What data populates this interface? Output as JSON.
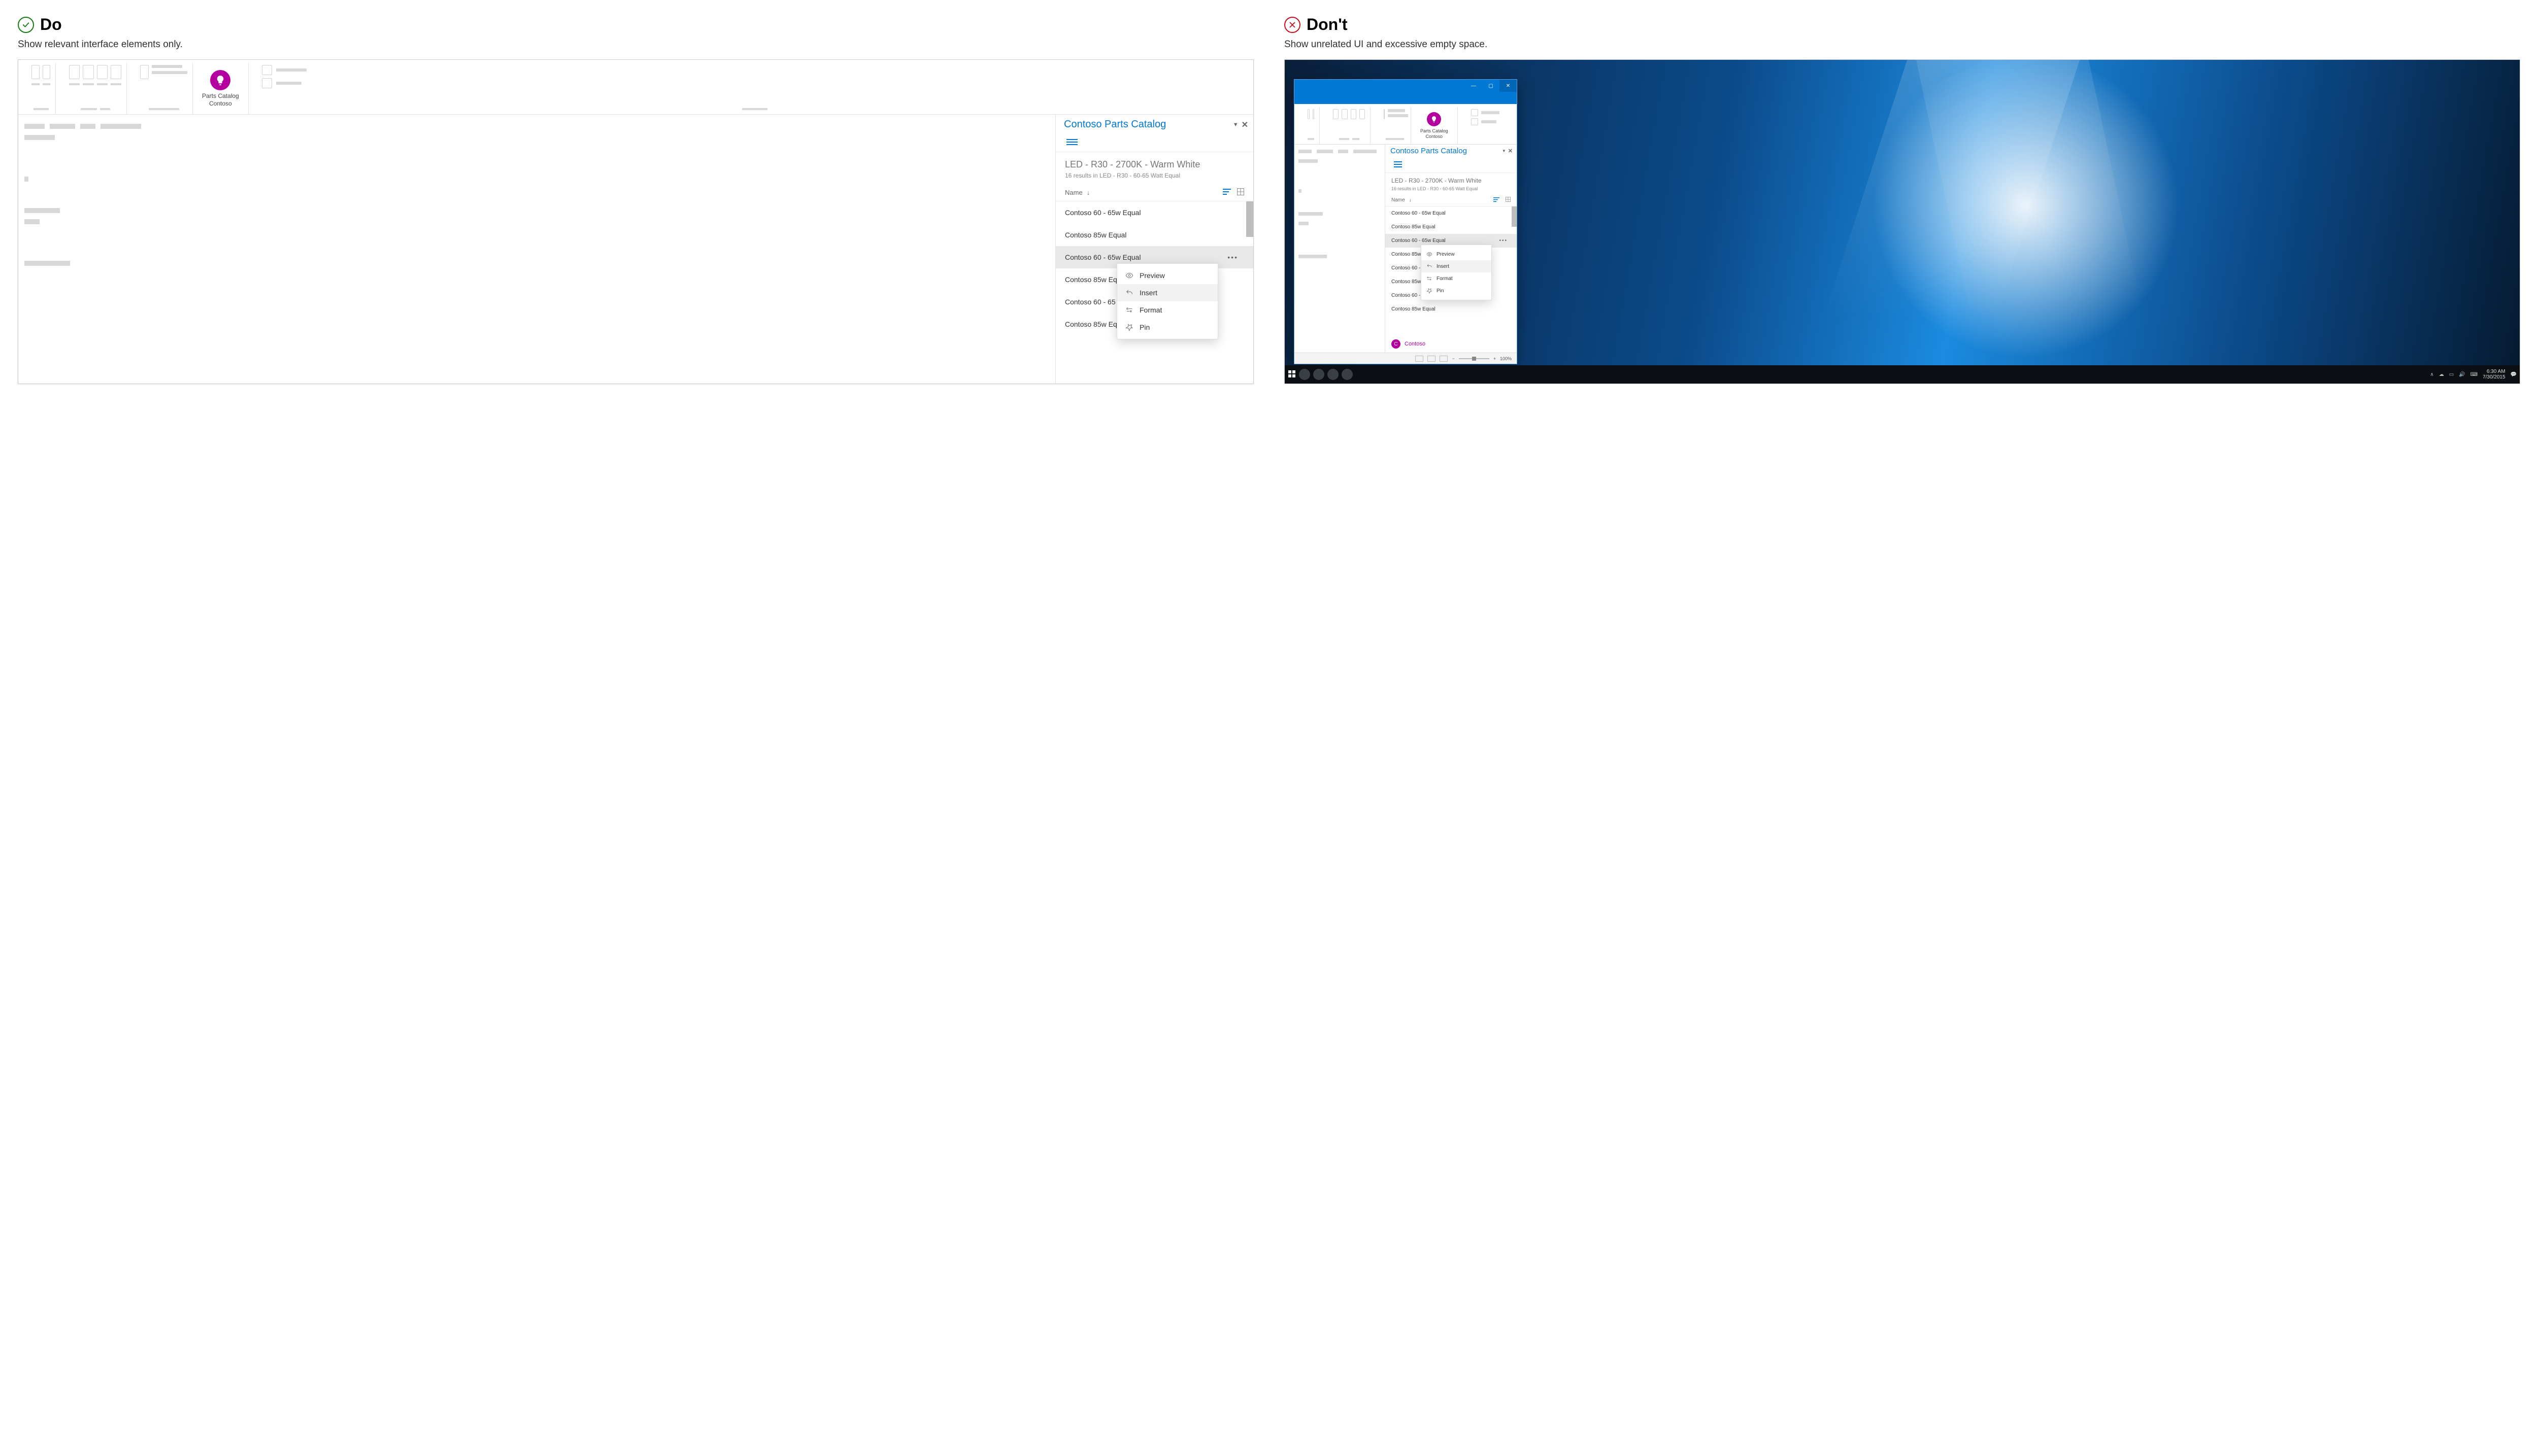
{
  "do": {
    "heading": "Do",
    "subtitle": "Show relevant interface elements only.",
    "ribbon_addin": {
      "line1": "Parts Catalog",
      "line2": "Contoso"
    },
    "pane": {
      "title": "Contoso Parts Catalog",
      "meta_title": "LED - R30 - 2700K - Warm White",
      "meta_sub": "16 results in LED - R30 - 60-65 Watt Equal",
      "sort_label": "Name",
      "items": [
        "Contoso 60 - 65w Equal",
        "Contoso 85w Equal",
        "Contoso 60 - 65w Equal",
        "Contoso 85w Eq",
        "Contoso 60 - 65",
        "Contoso 85w Eq"
      ],
      "selected_index": 2,
      "context_menu": [
        "Preview",
        "Insert",
        "Format",
        "Pin"
      ],
      "context_hover_index": 1
    }
  },
  "dont": {
    "heading": "Don't",
    "subtitle": "Show unrelated UI and excessive empty space.",
    "ribbon_addin": {
      "line1": "Parts Catalog",
      "line2": "Contoso"
    },
    "pane": {
      "title": "Contoso Parts Catalog",
      "meta_title": "LED - R30 - 2700K - Warm White",
      "meta_sub": "16 results in LED - R30 - 60-65 Watt Equal",
      "sort_label": "Name",
      "items": [
        "Contoso 60 - 65w Equal",
        "Contoso 85w Equal",
        "Contoso 60 - 65w Equal",
        "Contoso 85w Equal",
        "Contoso 60 - 65",
        "Contoso 85w Eq",
        "Contoso 60 - 65w Equal",
        "Contoso 85w Equal"
      ],
      "selected_index": 2,
      "context_menu": [
        "Preview",
        "Insert",
        "Format",
        "Pin"
      ],
      "context_hover_index": 1,
      "user": {
        "initial": "C",
        "name": "Contoso"
      }
    },
    "statusbar": {
      "zoom": "100%"
    },
    "taskbar": {
      "time": "6:30 AM",
      "date": "7/30/2015"
    }
  }
}
